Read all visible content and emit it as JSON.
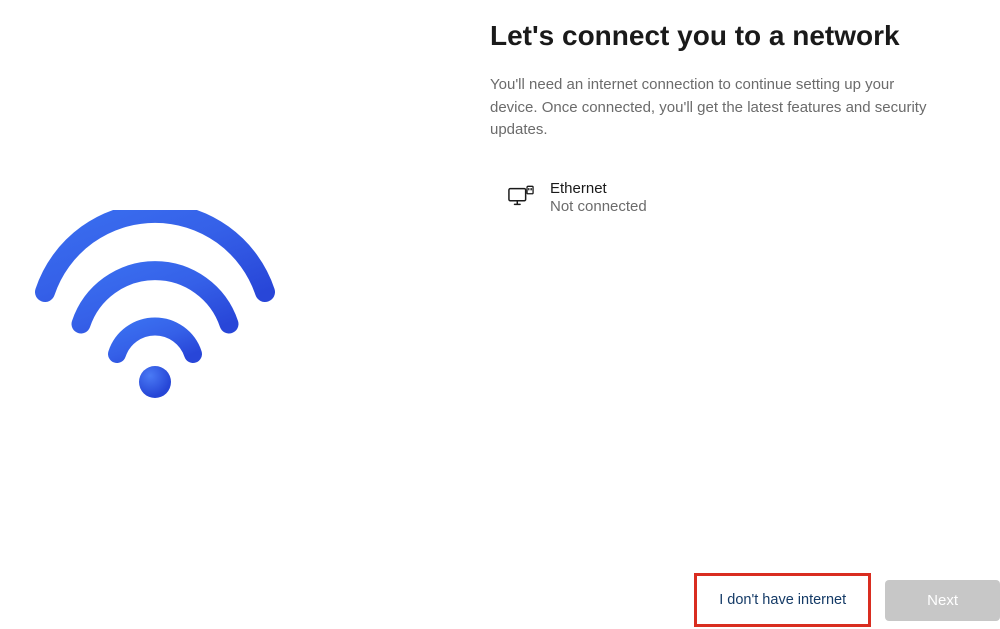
{
  "header": {
    "title": "Let's connect you to a network",
    "subtitle": "You'll need an internet connection to continue setting up your device. Once connected, you'll get the latest features and security updates."
  },
  "networks": [
    {
      "name": "Ethernet",
      "status": "Not connected"
    }
  ],
  "actions": {
    "no_internet_label": "I don't have internet",
    "next_label": "Next"
  }
}
